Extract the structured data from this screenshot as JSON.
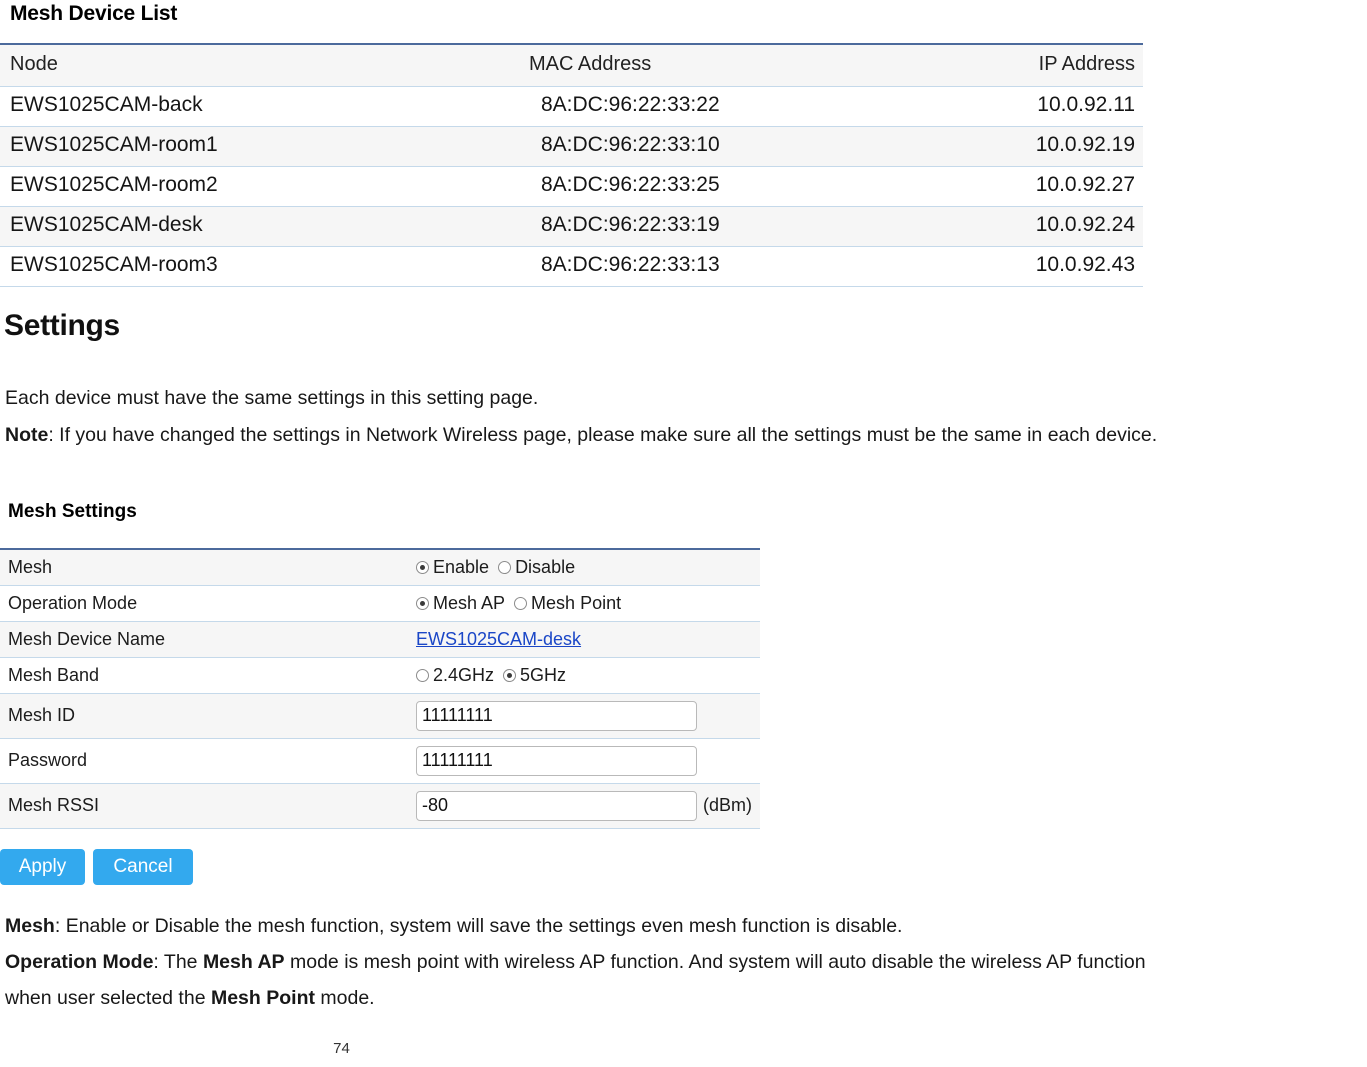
{
  "device_list": {
    "heading": "Mesh Device List",
    "columns": [
      "Node",
      "MAC Address",
      "IP Address"
    ],
    "rows": [
      {
        "node": "EWS1025CAM-back",
        "mac": "8A:DC:96:22:33:22",
        "ip": "10.0.92.11"
      },
      {
        "node": "EWS1025CAM-room1",
        "mac": "8A:DC:96:22:33:10",
        "ip": "10.0.92.19"
      },
      {
        "node": "EWS1025CAM-room2",
        "mac": "8A:DC:96:22:33:25",
        "ip": "10.0.92.27"
      },
      {
        "node": "EWS1025CAM-desk",
        "mac": "8A:DC:96:22:33:19",
        "ip": "10.0.92.24"
      },
      {
        "node": "EWS1025CAM-room3",
        "mac": "8A:DC:96:22:33:13",
        "ip": "10.0.92.43"
      }
    ]
  },
  "settings_section": {
    "heading": "Settings",
    "intro": "Each device must have the same settings in this setting page.",
    "note_label": "Note",
    "note_text": ": If you have changed the settings in Network Wireless page, please make sure all the settings must be the same in each device."
  },
  "mesh_settings": {
    "heading": "Mesh Settings",
    "rows": {
      "mesh": {
        "label": "Mesh",
        "options": [
          "Enable",
          "Disable"
        ],
        "selected": "Enable"
      },
      "operation_mode": {
        "label": "Operation Mode",
        "options": [
          "Mesh AP",
          "Mesh Point"
        ],
        "selected": "Mesh AP"
      },
      "device_name": {
        "label": "Mesh Device Name",
        "value": "EWS1025CAM-desk"
      },
      "band": {
        "label": "Mesh Band",
        "options": [
          "2.4GHz",
          "5GHz"
        ],
        "selected": "5GHz"
      },
      "mesh_id": {
        "label": "Mesh ID",
        "value": "11111111"
      },
      "password": {
        "label": "Password",
        "value": "11111111"
      },
      "rssi": {
        "label": "Mesh RSSI",
        "value": "-80",
        "unit": "(dBm)"
      }
    }
  },
  "buttons": {
    "apply": "Apply",
    "cancel": "Cancel"
  },
  "descriptions": {
    "mesh_label": "Mesh",
    "mesh_text": ": Enable or Disable the mesh function, system will save the settings even mesh function is disable.",
    "op_label": "Operation Mode",
    "op_text_1": ": The ",
    "op_bold_1": "Mesh AP",
    "op_text_2": " mode is mesh point with wireless AP function. And system will auto disable the wireless AP function",
    "op_text_3": "when user selected the ",
    "op_bold_2": "Mesh Point",
    "op_text_4": " mode."
  },
  "footer": {
    "page_number": "74"
  },
  "colors": {
    "accent_blue": "#4c6a9c",
    "row_border": "#c5d9ea",
    "button_blue": "#33a9ee",
    "link_blue": "#1a46c7",
    "row_alt": "#f6f6f6"
  }
}
